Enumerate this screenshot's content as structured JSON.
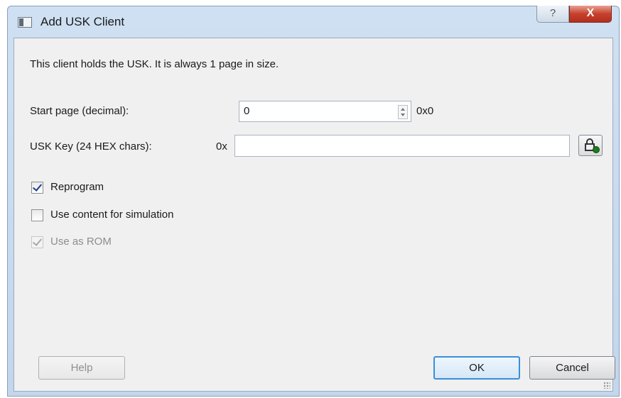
{
  "window": {
    "title": "Add USK Client",
    "help_glyph": "?",
    "close_glyph": "X"
  },
  "intro": "This client holds the USK. It is always 1 page in size.",
  "start_page": {
    "label": "Start page (decimal):",
    "value": "0",
    "hex_value": "0x0"
  },
  "usk_key": {
    "label": "USK Key (24 HEX chars):",
    "prefix": "0x",
    "value": "",
    "button_icon": "lock-icon"
  },
  "options": {
    "reprogram": {
      "label": "Reprogram",
      "checked": true
    },
    "use_content": {
      "label": "Use content for simulation",
      "checked": false
    },
    "use_as_rom": {
      "label": "Use as ROM",
      "checked": true,
      "disabled": true
    }
  },
  "buttons": {
    "help": "Help",
    "ok": "OK",
    "cancel": "Cancel"
  }
}
